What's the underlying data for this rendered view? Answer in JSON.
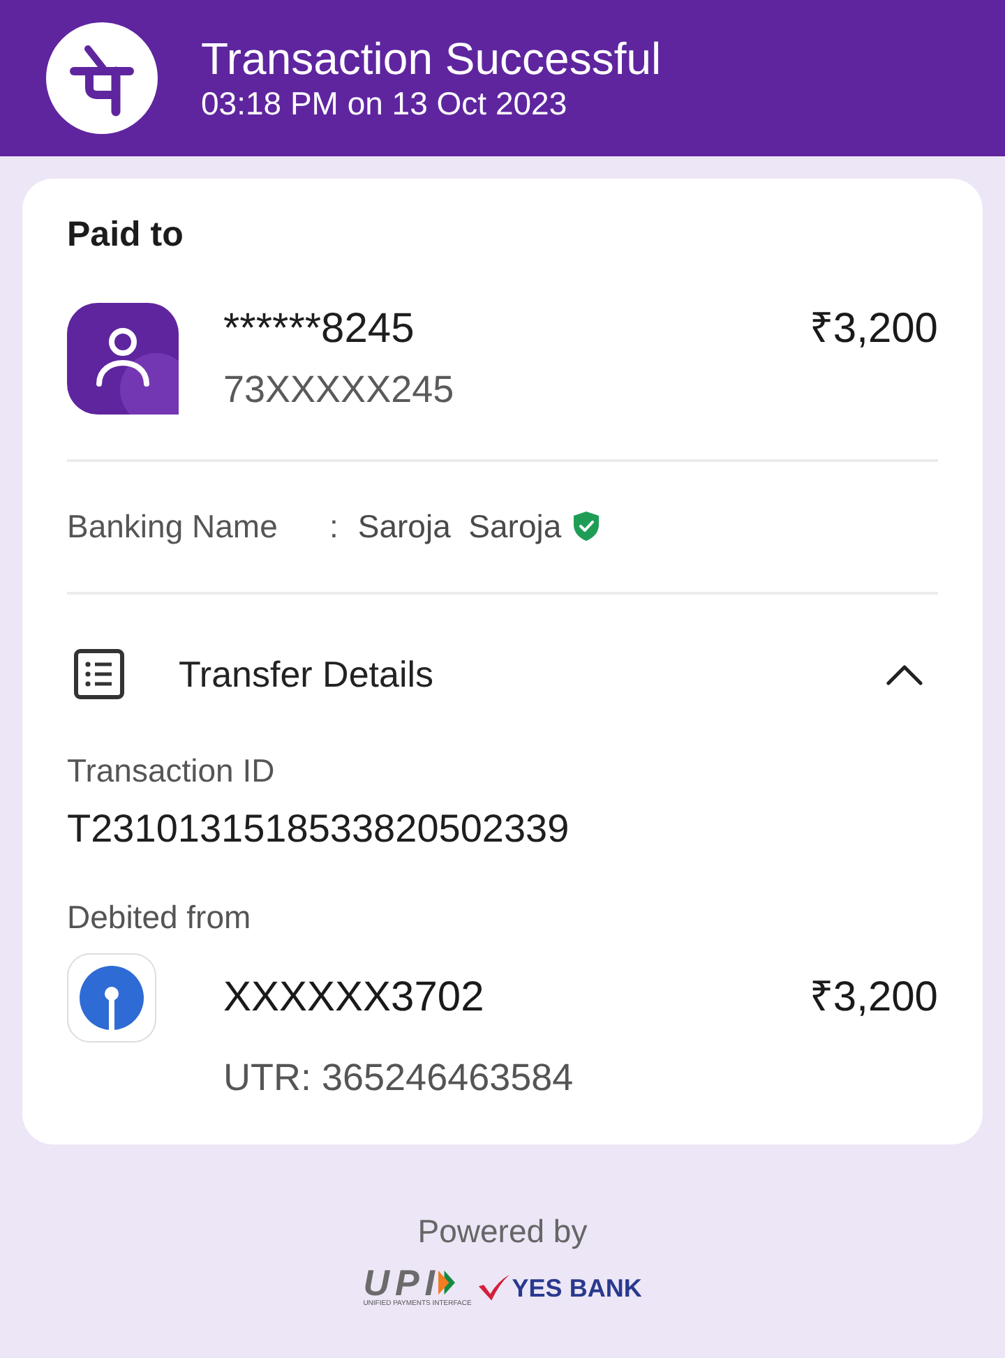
{
  "header": {
    "title": "Transaction Successful",
    "subtitle": "03:18 PM on 13 Oct 2023"
  },
  "paid_to": {
    "heading": "Paid to",
    "payee": {
      "name": "******8245",
      "upi_id": "73XXXXX245",
      "amount": "₹3,200"
    },
    "banking_name": {
      "label": "Banking Name",
      "separator": ":",
      "value": "Saroja  Saroja",
      "verified": true
    }
  },
  "transfer_details": {
    "title": "Transfer Details",
    "expanded": true,
    "transaction_id": {
      "label": "Transaction ID",
      "value": "T2310131518533820502339"
    },
    "debited_from": {
      "label": "Debited from",
      "account": "XXXXXX3702",
      "amount": "₹3,200",
      "utr": "UTR: 365246463584"
    }
  },
  "footer": {
    "powered_by": "Powered by",
    "upi": {
      "text": "UPI",
      "tagline": "UNIFIED PAYMENTS INTERFACE"
    },
    "bank": "YES BANK"
  }
}
